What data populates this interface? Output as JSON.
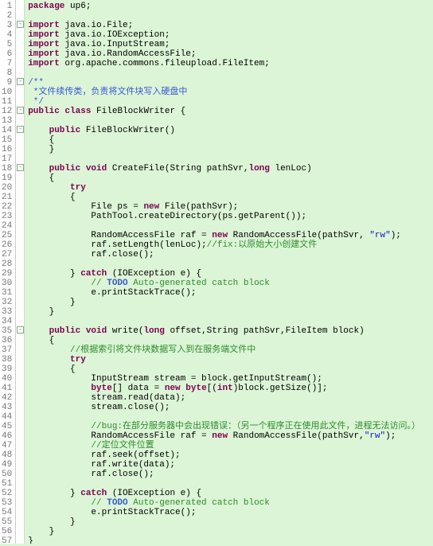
{
  "lines": [
    {
      "n": 1,
      "h": "<span class='kw'>package</span> up6;"
    },
    {
      "n": 2,
      "h": ""
    },
    {
      "n": 3,
      "h": "<span class='kw'>import</span> java.io.File;"
    },
    {
      "n": 4,
      "h": "<span class='kw'>import</span> java.io.IOException;"
    },
    {
      "n": 5,
      "h": "<span class='kw'>import</span> java.io.InputStream;"
    },
    {
      "n": 6,
      "h": "<span class='kw'>import</span> java.io.RandomAccessFile;"
    },
    {
      "n": 7,
      "h": "<span class='kw'>import</span> org.apache.commons.fileupload.FileItem;"
    },
    {
      "n": 8,
      "h": ""
    },
    {
      "n": 9,
      "h": "<span class='doc'>/**</span>"
    },
    {
      "n": 10,
      "h": "<span class='doc'> *文件续传类，负责将文件块写入硬盘中</span>"
    },
    {
      "n": 11,
      "h": "<span class='doc'> */</span>"
    },
    {
      "n": 12,
      "h": "<span class='kw'>public</span> <span class='kw'>class</span> FileBlockWriter {"
    },
    {
      "n": 13,
      "h": ""
    },
    {
      "n": 14,
      "h": "    <span class='kw'>public</span> FileBlockWriter()"
    },
    {
      "n": 15,
      "h": "    {"
    },
    {
      "n": 16,
      "h": "    }"
    },
    {
      "n": 17,
      "h": "    "
    },
    {
      "n": 18,
      "h": "    <span class='kw'>public</span> <span class='kw'>void</span> CreateFile(String pathSvr,<span class='kw'>long</span> lenLoc)"
    },
    {
      "n": 19,
      "h": "    {"
    },
    {
      "n": 20,
      "h": "        <span class='kw'>try</span>"
    },
    {
      "n": 21,
      "h": "        {"
    },
    {
      "n": 22,
      "h": "            File ps = <span class='kw'>new</span> File(pathSvr);"
    },
    {
      "n": 23,
      "h": "            PathTool.createDirectory(ps.getParent());"
    },
    {
      "n": 24,
      "h": "            "
    },
    {
      "n": 25,
      "h": "            RandomAccessFile raf = <span class='kw'>new</span> RandomAccessFile(pathSvr, <span class='str'>\"rw\"</span>);"
    },
    {
      "n": 26,
      "h": "            raf.setLength(lenLoc);<span class='cm'>//fix:以原始大小创建文件</span>"
    },
    {
      "n": 27,
      "h": "            raf.close();"
    },
    {
      "n": 28,
      "h": ""
    },
    {
      "n": 29,
      "h": "        } <span class='kw'>catch</span> (IOException e) {"
    },
    {
      "n": 30,
      "h": "            <span class='cm'>// <span class='doc' style='font-weight:bold'>TODO</span> Auto-generated catch block</span>"
    },
    {
      "n": 31,
      "h": "            e.printStackTrace();"
    },
    {
      "n": 32,
      "h": "        }"
    },
    {
      "n": 33,
      "h": "    }"
    },
    {
      "n": 34,
      "h": "    "
    },
    {
      "n": 35,
      "h": "    <span class='kw'>public</span> <span class='kw'>void</span> write(<span class='kw'>long</span> offset,String pathSvr,FileItem block)"
    },
    {
      "n": 36,
      "h": "    {       "
    },
    {
      "n": 37,
      "h": "        <span class='cm'>//根据索引将文件块数据写入到在服务端文件中</span>"
    },
    {
      "n": 38,
      "h": "        <span class='kw'>try</span>"
    },
    {
      "n": 39,
      "h": "        {"
    },
    {
      "n": 40,
      "h": "            InputStream stream = block.getInputStream();"
    },
    {
      "n": 41,
      "h": "            <span class='kw'>byte</span>[] data = <span class='kw'>new</span> <span class='kw'>byte</span>[(<span class='kw'>int</span>)block.getSize()];"
    },
    {
      "n": 42,
      "h": "            stream.read(data);"
    },
    {
      "n": 43,
      "h": "            stream.close();           "
    },
    {
      "n": 44,
      "h": "            "
    },
    {
      "n": 45,
      "h": "            <span class='cm'>//bug:在部分服务器中会出现错误：（另一个程序正在使用此文件，进程无法访问。）</span>"
    },
    {
      "n": 46,
      "h": "            RandomAccessFile raf = <span class='kw'>new</span> RandomAccessFile(pathSvr,<span class='str'>\"rw\"</span>);"
    },
    {
      "n": 47,
      "h": "            <span class='cm'>//定位文件位置</span>"
    },
    {
      "n": 48,
      "h": "            raf.seek(offset);"
    },
    {
      "n": 49,
      "h": "            raf.write(data);"
    },
    {
      "n": 50,
      "h": "            raf.close();"
    },
    {
      "n": 51,
      "h": "            "
    },
    {
      "n": 52,
      "h": "        } <span class='kw'>catch</span> (IOException e) {"
    },
    {
      "n": 53,
      "h": "            <span class='cm'>// <span class='doc' style='font-weight:bold'>TODO</span> Auto-generated catch block</span>"
    },
    {
      "n": 54,
      "h": "            e.printStackTrace();"
    },
    {
      "n": 55,
      "h": "        }      "
    },
    {
      "n": 56,
      "h": "    }"
    },
    {
      "n": 57,
      "h": "}"
    }
  ],
  "folds": [
    3,
    9,
    12,
    14,
    18,
    35
  ]
}
